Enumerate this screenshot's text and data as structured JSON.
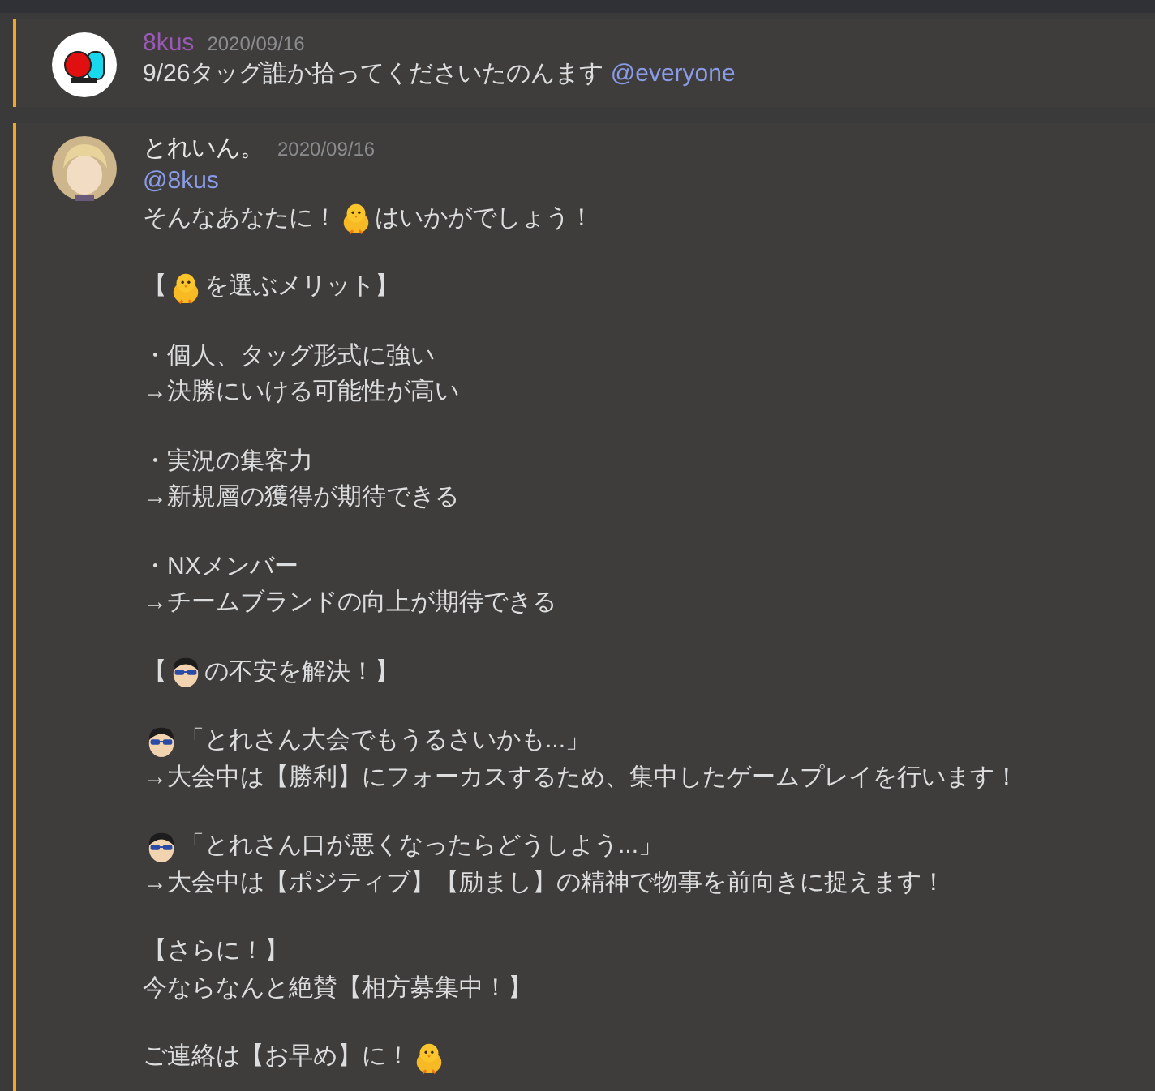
{
  "messages": [
    {
      "kind": "bot",
      "author": "8kus",
      "color": "#9b59b6",
      "timestamp": "2020/09/16",
      "mentioned": true,
      "paragraphs": [
        [
          [
            {
              "kind": "text",
              "text": "9/26タッグ誰か拾ってくださいたのんます "
            },
            {
              "kind": "mention",
              "text": "@everyone"
            }
          ]
        ]
      ]
    },
    {
      "kind": "person",
      "author": "とれいん。",
      "color": "#e8e8e8",
      "timestamp": "2020/09/16",
      "mentioned": true,
      "paragraphs": [
        [
          [
            {
              "kind": "mention",
              "text": "@8kus"
            }
          ],
          [
            {
              "kind": "text",
              "text": "そんなあなたに！"
            },
            {
              "kind": "chick"
            },
            {
              "kind": "text",
              "text": "はいかがでしょう！"
            }
          ]
        ],
        [
          [
            {
              "kind": "text",
              "text": "【"
            },
            {
              "kind": "chick"
            },
            {
              "kind": "text",
              "text": "を選ぶメリット】"
            }
          ]
        ],
        [
          [
            {
              "kind": "text",
              "text": "・個人、タッグ形式に強い"
            }
          ],
          [
            {
              "kind": "text",
              "text": "→決勝にいける可能性が高い"
            }
          ]
        ],
        [
          [
            {
              "kind": "text",
              "text": "・実況の集客力"
            }
          ],
          [
            {
              "kind": "text",
              "text": "→新規層の獲得が期待できる"
            }
          ]
        ],
        [
          [
            {
              "kind": "text",
              "text": "・NXメンバー"
            }
          ],
          [
            {
              "kind": "text",
              "text": "→チームブランドの向上が期待できる"
            }
          ]
        ],
        [
          [
            {
              "kind": "text",
              "text": "【"
            },
            {
              "kind": "face"
            },
            {
              "kind": "text",
              "text": "の不安を解決！】"
            }
          ]
        ],
        [
          [
            {
              "kind": "face"
            },
            {
              "kind": "text",
              "text": "「とれさん大会でもうるさいかも...」"
            }
          ],
          [
            {
              "kind": "text",
              "text": "→大会中は【勝利】にフォーカスするため、集中したゲームプレイを行います！"
            }
          ]
        ],
        [
          [
            {
              "kind": "face"
            },
            {
              "kind": "text",
              "text": "「とれさん口が悪くなったらどうしよう...」"
            }
          ],
          [
            {
              "kind": "text",
              "text": "→大会中は【ポジティブ】【励まし】の精神で物事を前向きに捉えます！"
            }
          ]
        ],
        [
          [
            {
              "kind": "text",
              "text": "【さらに！】"
            }
          ],
          [
            {
              "kind": "text",
              "text": "今ならなんと絶賛【相方募集中！】"
            }
          ]
        ],
        [
          [
            {
              "kind": "text",
              "text": "ご連絡は【お早め】に！"
            },
            {
              "kind": "chick"
            }
          ]
        ]
      ]
    }
  ]
}
